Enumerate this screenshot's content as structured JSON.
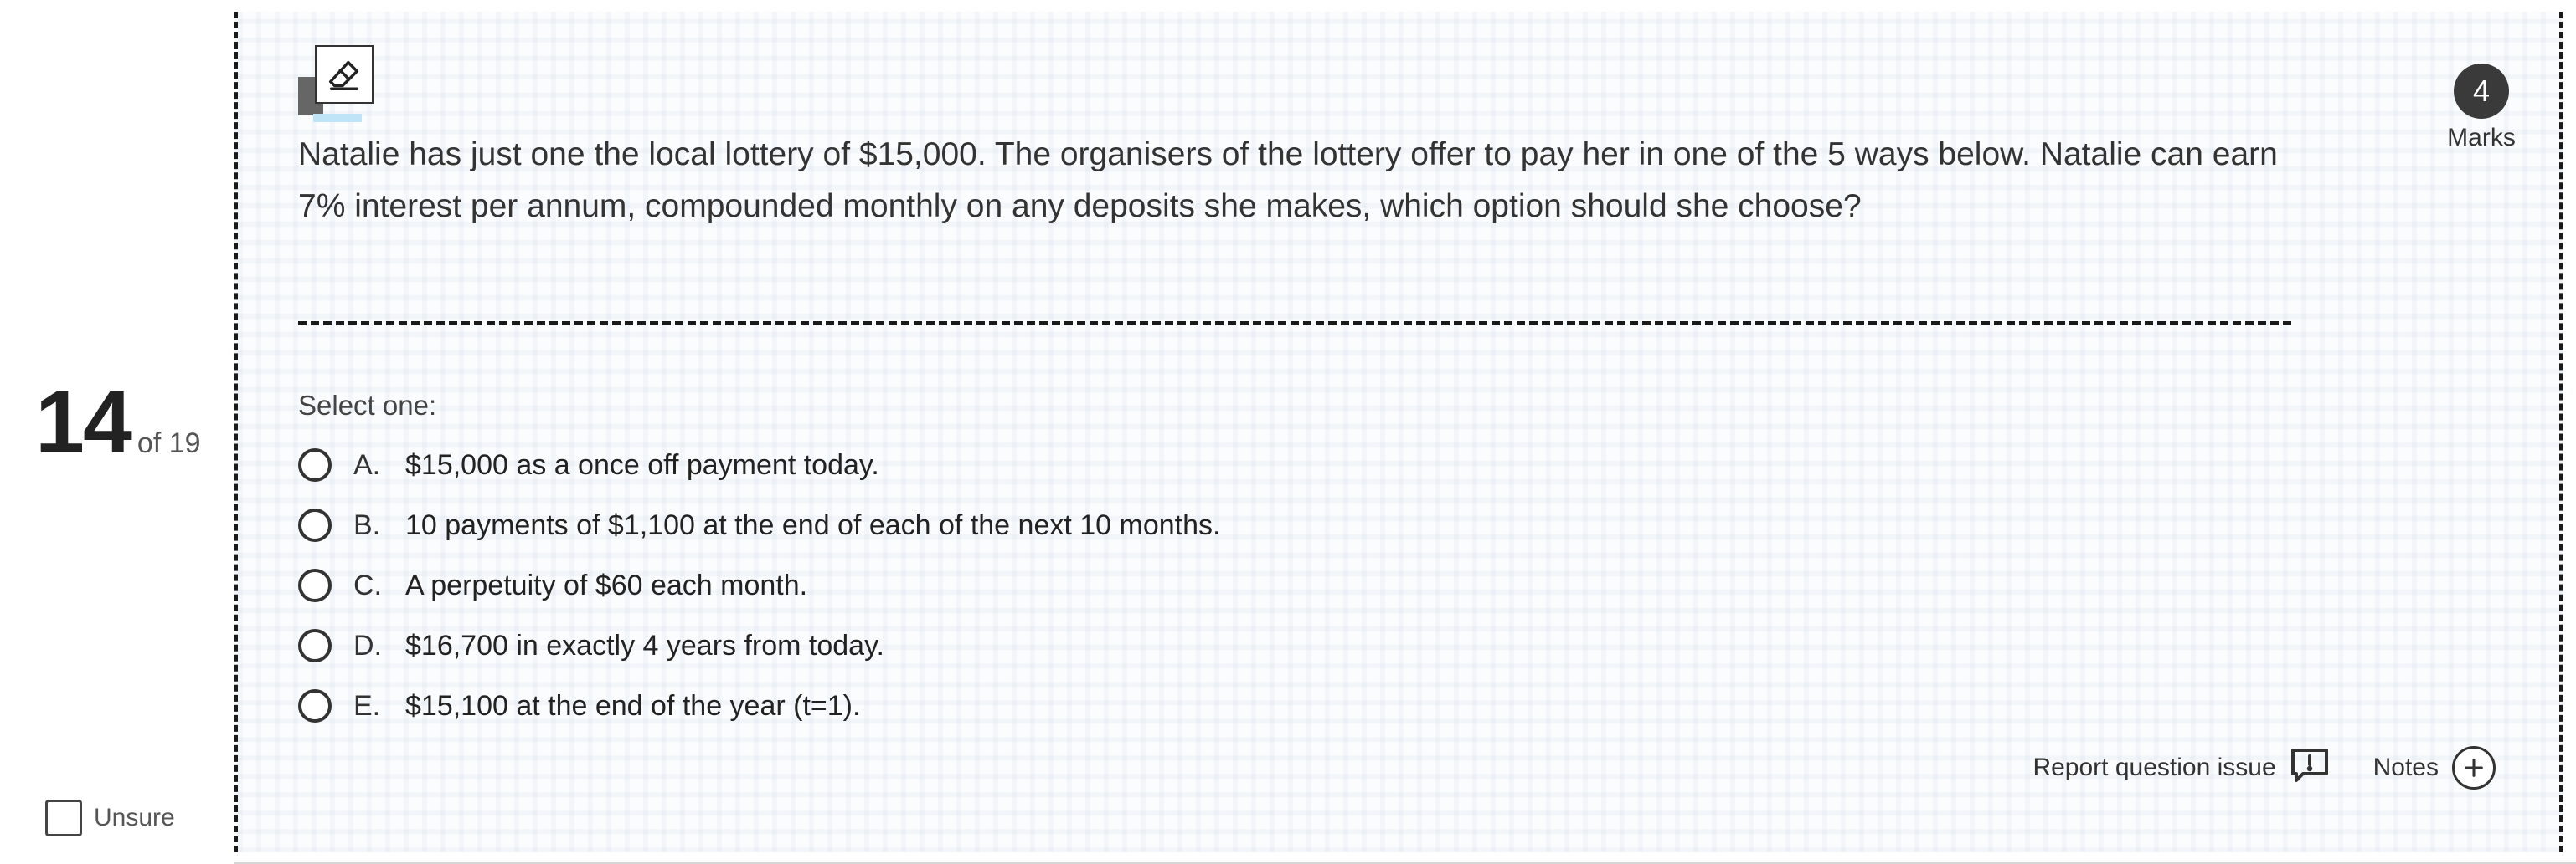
{
  "question_number": {
    "current": "14",
    "total_text": "of 19"
  },
  "unsure": {
    "label": "Unsure"
  },
  "marks": {
    "value": "4",
    "label": "Marks"
  },
  "question": {
    "text": "Natalie has just one the local lottery of $15,000. The organisers of the lottery offer to pay her in one of the 5 ways below. Natalie can earn 7% interest per annum, compounded monthly on any deposits she makes, which option should she choose?"
  },
  "select_label": "Select one:",
  "options": [
    {
      "letter": "A.",
      "text": "$15,000 as a once off payment today."
    },
    {
      "letter": "B.",
      "text": "10 payments of $1,100 at the end of each of the next 10 months."
    },
    {
      "letter": "C.",
      "text": "A perpetuity of $60 each month."
    },
    {
      "letter": "D.",
      "text": "$16,700 in exactly 4 years from today."
    },
    {
      "letter": "E.",
      "text": "$15,100 at the end of the year (t=1)."
    }
  ],
  "actions": {
    "report_label": "Report question issue",
    "notes_label": "Notes"
  },
  "icons": {
    "eraser": "eraser-icon",
    "report": "report-issue-icon",
    "notes": "plus-circle-icon"
  }
}
